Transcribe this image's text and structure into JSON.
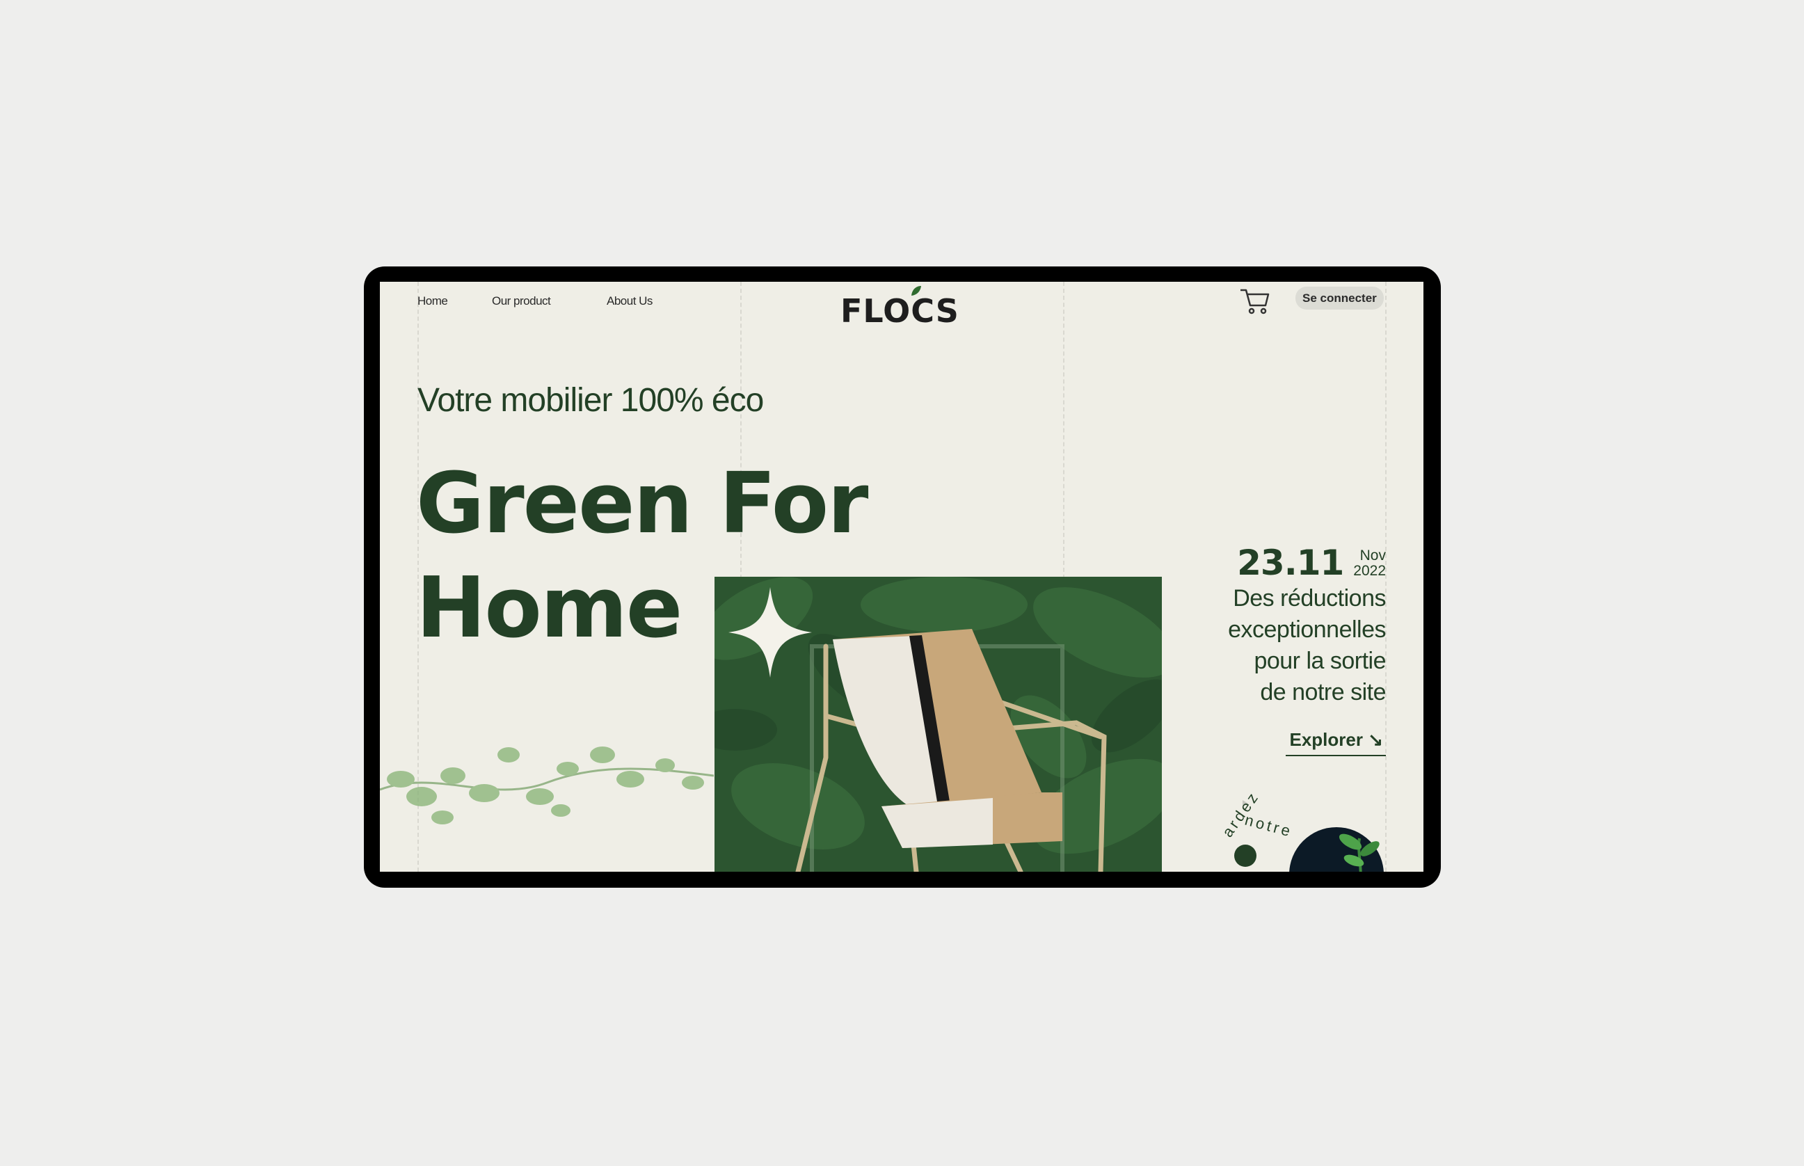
{
  "nav": {
    "home": "Home",
    "product": "Our product",
    "about": "About Us"
  },
  "brand": {
    "logo": "FLOCS"
  },
  "header": {
    "login": "Se connecter",
    "cart_icon": "cart-icon"
  },
  "hero": {
    "subtitle": "Votre mobilier 100% éco",
    "headline_line1": "Green For",
    "headline_line2": "Home"
  },
  "promo": {
    "day": "23.11",
    "month": "Nov",
    "year": "2022",
    "text": [
      "Des réductions",
      "exceptionnelles",
      "pour la sortie",
      "de notre site"
    ],
    "cta": "Explorer ↘"
  },
  "badge": {
    "circular_text_left": "ardez",
    "circular_text_right": "notre"
  },
  "colors": {
    "primary": "#234026",
    "background": "#efeee6",
    "frame": "#000000"
  }
}
